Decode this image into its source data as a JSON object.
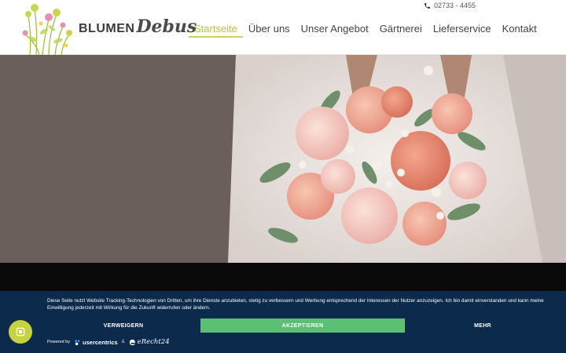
{
  "brand": {
    "name_part1": "BLUMEN",
    "name_part2": "Debus"
  },
  "header": {
    "phone": "02733 - 4455"
  },
  "nav": {
    "items": [
      {
        "label": "Startseite",
        "active": true
      },
      {
        "label": "Über uns",
        "active": false
      },
      {
        "label": "Unser Angebot",
        "active": false
      },
      {
        "label": "Gärtnerei",
        "active": false
      },
      {
        "label": "Lieferservice",
        "active": false
      },
      {
        "label": "Kontakt",
        "active": false
      }
    ]
  },
  "hero": {
    "image": "wedding-bouquet-photo"
  },
  "consent": {
    "text": "Diese Seite nutzt Website Tracking-Technologien von Dritten, um ihre Dienste anzubieten, stetig zu verbessern und Werbung entsprechend der Interessen der Nutzer anzuzeigen. Ich bin damit einverstanden und kann meine Einwilligung jederzeit mit Wirkung für die Zukunft widerrufen oder ändern.",
    "deny_label": "VERWEIGERN",
    "accept_label": "AKZEPTIEREN",
    "more_label": "MEHR",
    "powered_by": "Powered by",
    "uc_name": "usercentrics",
    "amp": "&",
    "er_name": "eRecht24"
  },
  "colors": {
    "accent": "#c9d552",
    "consent_bg": "#0b2a4c",
    "accept_green": "#5cc074"
  }
}
